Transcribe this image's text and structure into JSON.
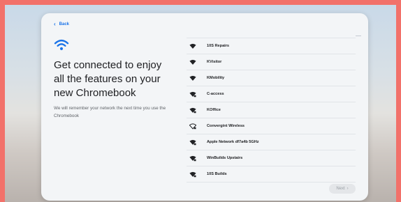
{
  "back_label": "Back",
  "title": "Get connected to enjoy all the features on your new Chromebook",
  "subtitle": "We will remember your network the next time you use the Chromebook",
  "networks": [
    {
      "name": "10S Repairs",
      "secured": false,
      "icon": "wifi-filled-icon"
    },
    {
      "name": "KVisitor",
      "secured": false,
      "icon": "wifi-filled-icon"
    },
    {
      "name": "KMobility",
      "secured": false,
      "icon": "wifi-filled-icon"
    },
    {
      "name": "C-access",
      "secured": true,
      "icon": "wifi-secured-icon"
    },
    {
      "name": "KOffice",
      "secured": true,
      "icon": "wifi-secured-icon"
    },
    {
      "name": "Convergint Wireless",
      "secured": true,
      "icon": "wifi-outline-secured-icon"
    },
    {
      "name": "Apple Network df7a4b 5GHz",
      "secured": true,
      "icon": "wifi-secured-icon"
    },
    {
      "name": "WinBuilds Upstairs",
      "secured": true,
      "icon": "wifi-secured-icon"
    },
    {
      "name": "10S Builds",
      "secured": true,
      "icon": "wifi-secured-icon"
    }
  ],
  "next_label": "Next",
  "colors": {
    "accent": "#1a73e8",
    "frame": "#f2716a",
    "card": "#f3f5f7"
  }
}
